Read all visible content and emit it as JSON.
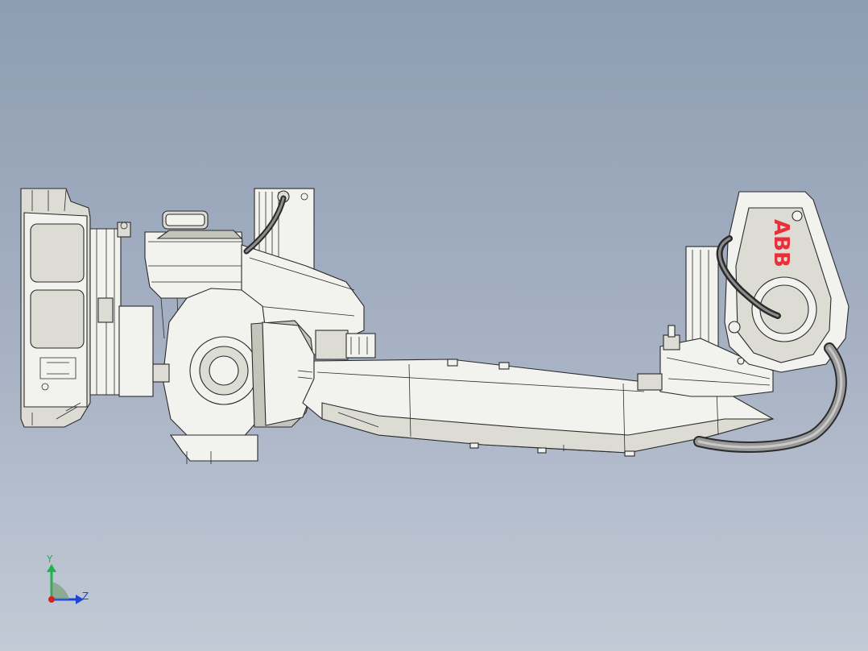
{
  "robot": {
    "logo_text": "ABB"
  },
  "triad": {
    "y_label": "Y",
    "z_label": "Z",
    "colors": {
      "y": "#1fb44a",
      "z": "#1d44d6",
      "x": "#d81f1f"
    }
  },
  "colors": {
    "logo": "#e8303a",
    "cable_outer": "#2b2b2b",
    "cable_inner": "#8c8c8c",
    "hose": "#9a9a9a"
  }
}
